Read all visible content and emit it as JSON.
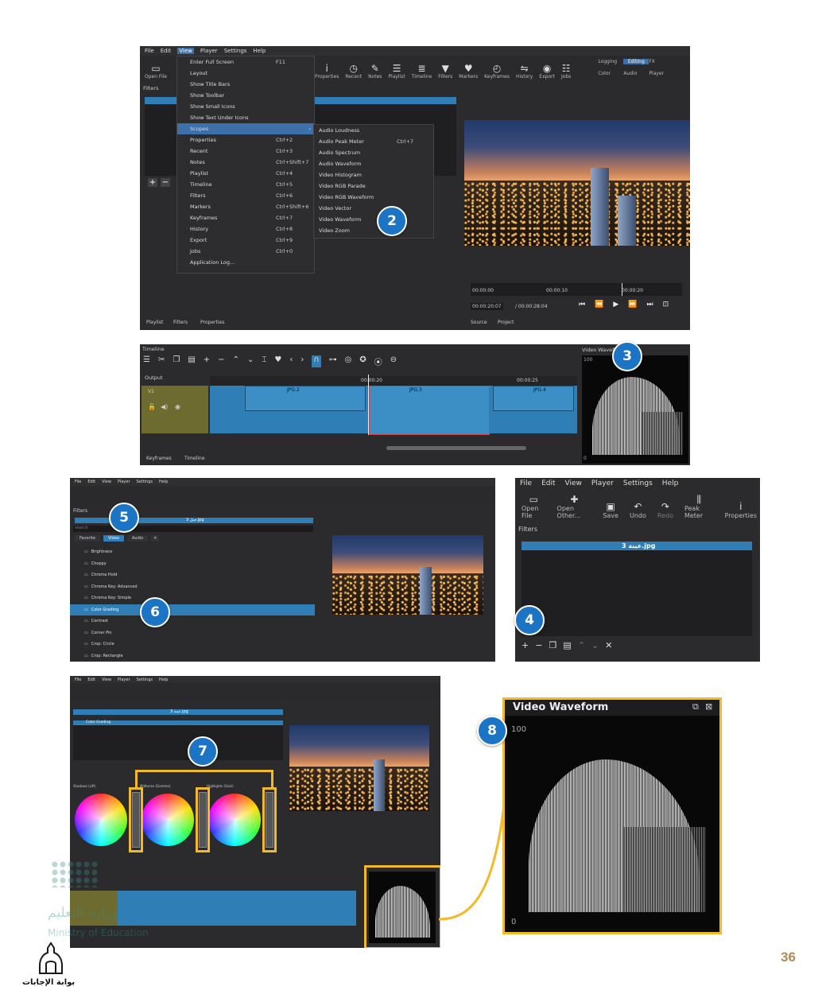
{
  "menus": [
    "File",
    "Edit",
    "View",
    "Player",
    "Settings",
    "Help"
  ],
  "toolbar_main": [
    "Open File",
    "Properties",
    "Recent",
    "Notes",
    "Playlist",
    "Timeline",
    "Filters",
    "Markers",
    "Keyframes",
    "History",
    "Export",
    "Jobs"
  ],
  "layout_tabs": [
    "Logging",
    "Editing",
    "FX"
  ],
  "layout_sub": [
    "Color",
    "Audio",
    "Player"
  ],
  "view_menu": [
    {
      "label": "Enter Full Screen",
      "shortcut": "F11"
    },
    {
      "label": "Layout",
      "shortcut": ""
    },
    {
      "label": "Show Title Bars",
      "shortcut": ""
    },
    {
      "label": "Show Toolbar",
      "shortcut": ""
    },
    {
      "label": "Show Small Icons",
      "shortcut": ""
    },
    {
      "label": "Show Text Under Icons",
      "shortcut": ""
    },
    {
      "label": "Scopes",
      "shortcut": ""
    },
    {
      "label": "Properties",
      "shortcut": "Ctrl+2"
    },
    {
      "label": "Recent",
      "shortcut": "Ctrl+3"
    },
    {
      "label": "Notes",
      "shortcut": "Ctrl+Shift+7"
    },
    {
      "label": "Playlist",
      "shortcut": "Ctrl+4"
    },
    {
      "label": "Timeline",
      "shortcut": "Ctrl+5"
    },
    {
      "label": "Filters",
      "shortcut": "Ctrl+6"
    },
    {
      "label": "Markers",
      "shortcut": "Ctrl+Shift+6"
    },
    {
      "label": "Keyframes",
      "shortcut": "Ctrl+7"
    },
    {
      "label": "History",
      "shortcut": "Ctrl+8"
    },
    {
      "label": "Export",
      "shortcut": "Ctrl+9"
    },
    {
      "label": "Jobs",
      "shortcut": "Ctrl+0"
    },
    {
      "label": "Application Log...",
      "shortcut": ""
    }
  ],
  "scopes_menu": [
    {
      "label": "Audio Loudness",
      "shortcut": ""
    },
    {
      "label": "Audio Peak Meter",
      "shortcut": "Ctrl+7"
    },
    {
      "label": "Audio Spectrum",
      "shortcut": ""
    },
    {
      "label": "Audio Waveform",
      "shortcut": ""
    },
    {
      "label": "Video Histogram",
      "shortcut": ""
    },
    {
      "label": "Video RGB Parade",
      "shortcut": ""
    },
    {
      "label": "Video RGB Waveform",
      "shortcut": ""
    },
    {
      "label": "Video Vector",
      "shortcut": ""
    },
    {
      "label": "Video Waveform",
      "shortcut": ""
    },
    {
      "label": "Video Zoom",
      "shortcut": ""
    }
  ],
  "shot1": {
    "filters_title": "Filters",
    "bottom_tabs": [
      "Playlist",
      "Filters",
      "Properties"
    ],
    "source_tabs": [
      "Source",
      "Project"
    ],
    "ruler": [
      "00:00:00",
      "00:00:10",
      "00:00:20"
    ],
    "timecode_current": "00:00:20:07",
    "timecode_total": "/ 00:00:28:04"
  },
  "shot2": {
    "title": "Timeline",
    "output": "Output",
    "track": "V1",
    "ruler": [
      "00:00:20",
      "00:00:25"
    ],
    "clips": [
      "JPG.2",
      "JPG.3",
      "JPG.4"
    ],
    "bottom_tabs": [
      "Keyframes",
      "Timeline"
    ],
    "scope_title": "Video Waveform",
    "scope_max": "100",
    "scope_min": "0"
  },
  "shot3": {
    "title": "Filters",
    "search_placeholder": "search",
    "clip_label": "جبل 3.jpg",
    "tabs": [
      "Favorite",
      "Video",
      "Audio"
    ],
    "filters": [
      "Brightness",
      "Choppy",
      "Chroma Hold",
      "Chroma Key: Advanced",
      "Chroma Key: Simple",
      "Color Grading",
      "Contrast",
      "Corner Pin",
      "Crop: Circle",
      "Crop: Rectangle"
    ],
    "selected_filter": "Color Grading"
  },
  "shot4": {
    "menus": [
      "File",
      "Edit",
      "View",
      "Player",
      "Settings",
      "Help"
    ],
    "tools": [
      "Open File",
      "Open Other...",
      "Save",
      "Undo",
      "Redo",
      "Peak Meter",
      "Properties"
    ],
    "filters_title": "Filters",
    "clip_label": "عينة 3.jpg"
  },
  "shot5": {
    "clip_label": "عينة 3.jpg",
    "filter_item": "Color Grading",
    "wheel_labels": [
      "Shadows (Lift)",
      "Midtones (Gamma)",
      "Highlights (Gain)"
    ]
  },
  "zoom": {
    "title": "Video Waveform",
    "max": "100",
    "min": "0"
  },
  "badges": [
    "2",
    "3",
    "4",
    "5",
    "6",
    "7",
    "8"
  ],
  "watermark": {
    "arabic": "وزارة التعليم",
    "english": "Ministry of Education",
    "logo_text": "بوابة الإجابات"
  },
  "page_number": "36",
  "colors": {
    "accent_blue": "#1b74c4",
    "highlight_gold": "#f2b928",
    "page_number": "#b08a57"
  }
}
